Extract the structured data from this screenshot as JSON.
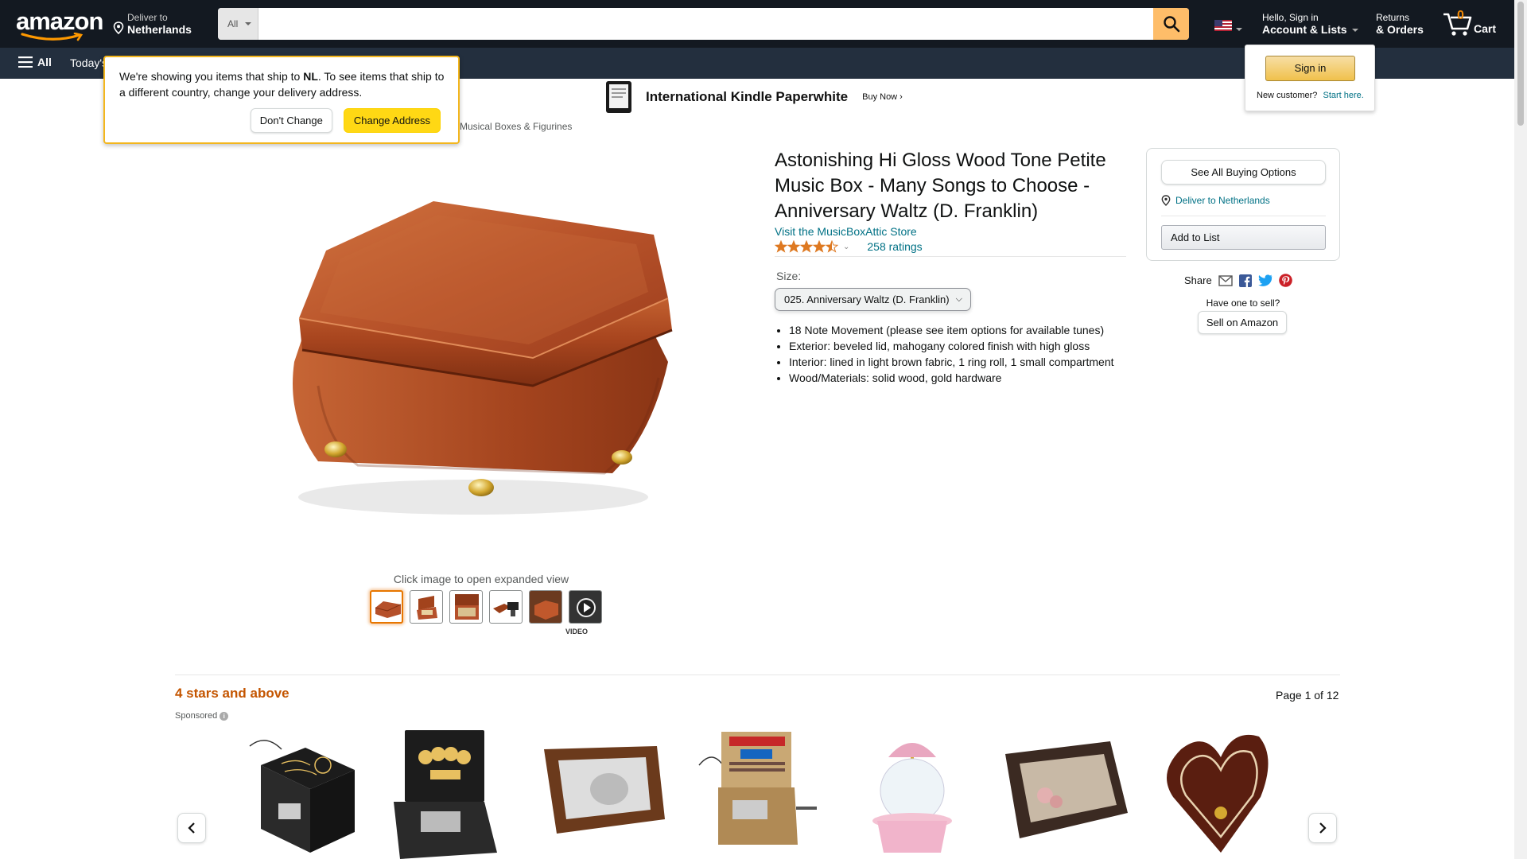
{
  "nav": {
    "logo": "amazon",
    "deliver_line1": "Deliver to",
    "deliver_line2": "Netherlands",
    "search_category": "All",
    "search_placeholder": "",
    "account_line1": "Hello, Sign in",
    "account_line2": "Account & Lists",
    "returns_line1": "Returns",
    "returns_line2": "& Orders",
    "cart_count": "0",
    "cart_label": "Cart"
  },
  "subnav": {
    "all_label": "All",
    "today_label": "Today's"
  },
  "kindle_ad": {
    "title": "International Kindle Paperwhite",
    "cta": "Buy Now ›"
  },
  "country_popover": {
    "message_part1": "We're showing you items that ship to ",
    "country_code": "NL",
    "message_part2": ". To see items that ship to a different country, change your delivery address.",
    "dont_change": "Don't Change",
    "change_address": "Change Address"
  },
  "signin_flyout": {
    "signin_button": "Sign in",
    "new_customer": "New customer?",
    "start_here": "Start here."
  },
  "breadcrumb": "Musical Boxes & Figurines",
  "product": {
    "title": "Astonishing Hi Gloss Wood Tone Petite Music Box - Many Songs to Choose - Anniversary Waltz (D. Franklin)",
    "store_link": "Visit the MusicBoxAttic Store",
    "rating_value": 4.5,
    "ratings_count": "258 ratings",
    "size_label": "Size:",
    "size_selected": "025. Anniversary Waltz (D. Franklin)",
    "bullets": [
      "18 Note Movement (please see item options for available tunes)",
      "Exterior: beveled lid, mahogany colored finish with high gloss",
      "Interior: lined in light brown fabric, 1 ring roll, 1 small compartment",
      "Wood/Materials: solid wood, gold hardware"
    ],
    "image_caption": "Click image to open expanded view",
    "video_label": "VIDEO"
  },
  "buybox": {
    "see_all": "See All Buying Options",
    "deliver_to": "Deliver to Netherlands",
    "add_to_list": "Add to List",
    "share_label": "Share",
    "have_one": "Have one to sell?",
    "sell_on_amazon": "Sell on Amazon"
  },
  "carousel": {
    "heading": "4 stars and above",
    "page_info": "Page 1 of 12",
    "sponsored": "Sponsored"
  },
  "colors": {
    "nav_bg": "#131921",
    "subnav_bg": "#232f3e",
    "search_button": "#febd69",
    "link": "#007185",
    "heading_orange": "#c45500",
    "button_yellow": "#ffd814",
    "star": "#de7921",
    "wood": "#b5502a"
  }
}
